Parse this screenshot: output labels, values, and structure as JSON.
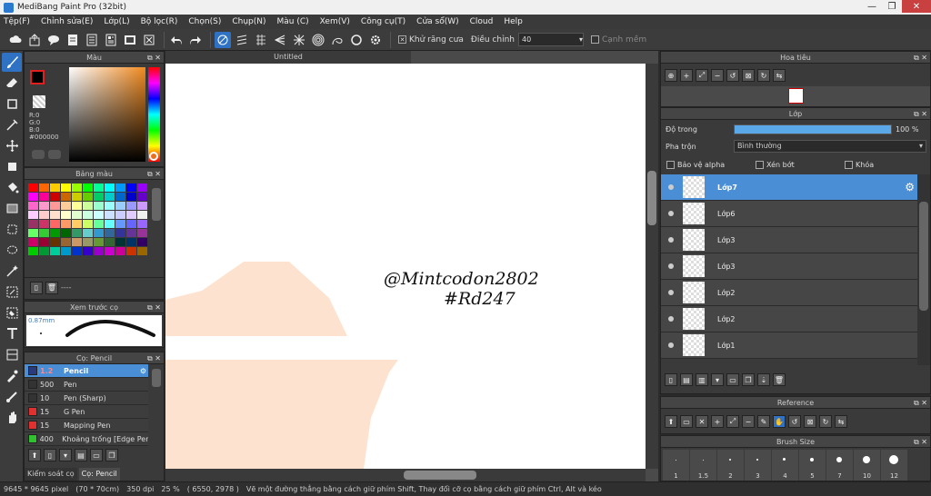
{
  "window": {
    "title": "MediBang Paint Pro (32bit)"
  },
  "menu": [
    "Tệp(F)",
    "Chỉnh sửa(E)",
    "Lớp(L)",
    "Bộ lọc(R)",
    "Chọn(S)",
    "Chụp(N)",
    "Màu (C)",
    "Xem(V)",
    "Công cụ(T)",
    "Cửa sổ(W)",
    "Cloud",
    "Help"
  ],
  "toolbar": {
    "antialias_label": "Khử răng cưa",
    "adjust_label": "Điều chỉnh",
    "adjust_value": "40",
    "edge_label": "Cạnh mềm"
  },
  "color_panel": {
    "title": "Màu",
    "r": "R:0",
    "g": "G:0",
    "b": "B:0",
    "hex": "#000000"
  },
  "palette_panel": {
    "title": "Bảng màu",
    "footer": "----"
  },
  "preview_panel": {
    "title": "Xem trước cọ",
    "size": "0.87mm"
  },
  "brush_panel": {
    "title": "Cọ: Pencil",
    "brushes": [
      {
        "size": "1.2",
        "name": "Pencil",
        "color": "#2a3a7a"
      },
      {
        "size": "500",
        "name": "Pen",
        "color": "#333333"
      },
      {
        "size": "10",
        "name": "Pen (Sharp)",
        "color": "#333333"
      },
      {
        "size": "15",
        "name": "G Pen",
        "color": "#e03030"
      },
      {
        "size": "15",
        "name": "Mapping Pen",
        "color": "#e03030"
      },
      {
        "size": "400",
        "name": "Khoảng trống [Edge Pen]",
        "color": "#30c030"
      }
    ],
    "tab1": "Kiểm soát cọ",
    "tab2": "Cọ: Pencil"
  },
  "document": {
    "tab": "Untitled",
    "watermark_line1": "@Mintcodon2802",
    "watermark_line2": "#Rd247"
  },
  "navigator_panel": {
    "title": "Hoa tiêu"
  },
  "layer_panel": {
    "title": "Lớp",
    "opacity_label": "Độ trong",
    "opacity_value": "100 %",
    "opacity_fraction": 1.0,
    "blend_label": "Pha trộn",
    "blend_value": "Bình thường",
    "protect_alpha": "Bảo vệ alpha",
    "clip": "Xén bớt",
    "lock": "Khóa",
    "layers": [
      "Lớp7",
      "Lớp6",
      "Lớp3",
      "Lớp3",
      "Lớp2",
      "Lớp2",
      "Lớp1"
    ]
  },
  "reference_panel": {
    "title": "Reference"
  },
  "brushsize_panel": {
    "title": "Brush Size",
    "sizes": [
      "1",
      "1.5",
      "2",
      "3",
      "4",
      "5",
      "7",
      "10",
      "12"
    ]
  },
  "status": {
    "size": "9645 * 9645 pixel",
    "cm": "(70 * 70cm)",
    "dpi": "350 dpi",
    "zoom": "25 %",
    "coords": "( 6550, 2978 )",
    "hint": "Vẽ một đường thẳng bằng cách giữ phím Shift, Thay đổi cỡ cọ bằng cách giữ phím Ctrl, Alt và kéo"
  },
  "colors": {
    "accent": "#4a8fd6",
    "selected_tool": "#2f72c4",
    "shape": "#fde3cf"
  }
}
